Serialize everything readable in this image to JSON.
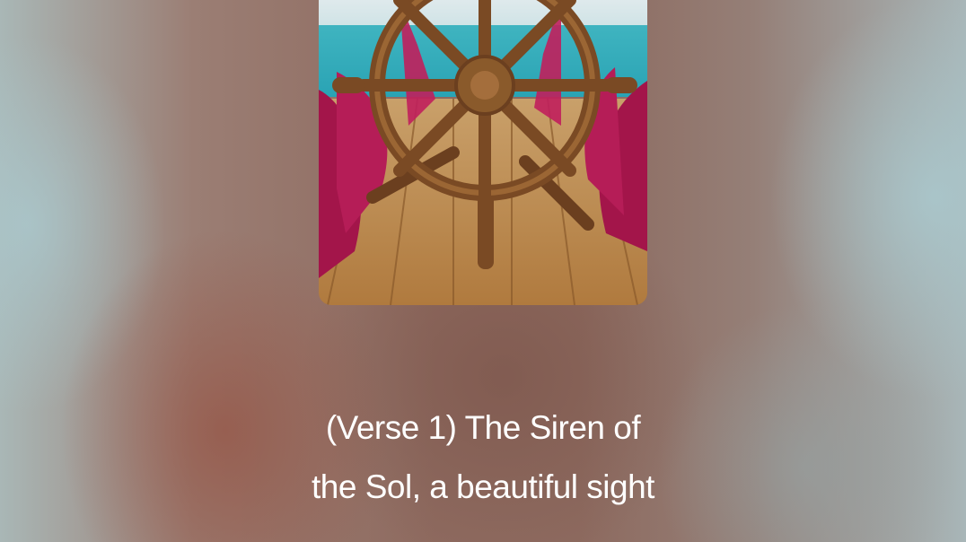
{
  "player": {
    "artwork_icon": "ship-wheel-artwork",
    "lyrics": {
      "line1": "(Verse 1) The Siren of",
      "line2": "the Sol, a beautiful sight"
    }
  },
  "colors": {
    "lyric_text": "#ffffff",
    "background_warm": "#8e6a5f",
    "background_cool": "#a9b7b6"
  }
}
